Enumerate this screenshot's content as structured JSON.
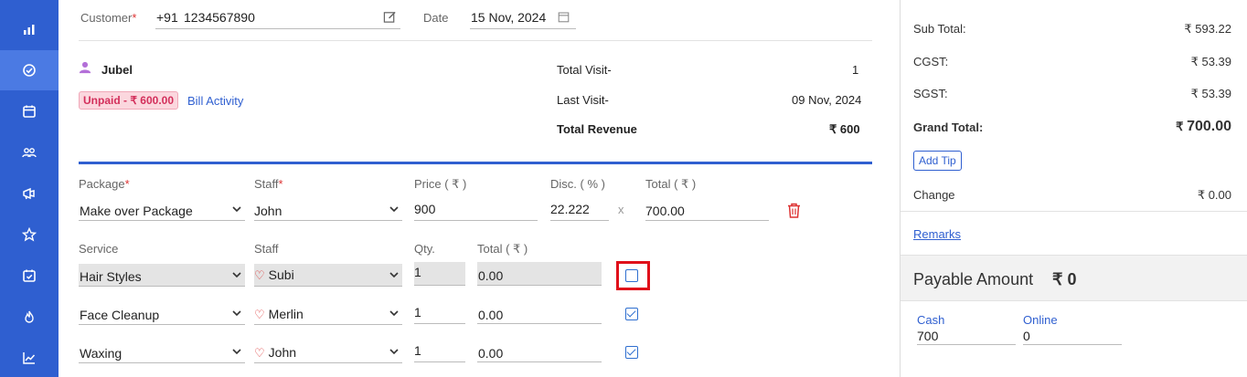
{
  "sidebar": {
    "items": [
      {
        "icon": "bar-chart-icon",
        "active": false
      },
      {
        "icon": "check-circle-icon",
        "active": true
      },
      {
        "icon": "calendar-icon",
        "active": false
      },
      {
        "icon": "group-icon",
        "active": false
      },
      {
        "icon": "megaphone-icon",
        "active": false
      },
      {
        "icon": "star-icon",
        "active": false
      },
      {
        "icon": "calendar-check-icon",
        "active": false
      },
      {
        "icon": "fire-icon",
        "active": false
      },
      {
        "icon": "trend-chart-icon",
        "active": false
      }
    ]
  },
  "customer": {
    "label": "Customer",
    "required_mark": "*",
    "country_code": "+91",
    "phone": "1234567890",
    "date_label": "Date",
    "date_value": "15 Nov, 2024"
  },
  "client": {
    "name": "Jubel",
    "unpaid_badge": "Unpaid - ₹ 600.00",
    "bill_activity": "Bill Activity",
    "total_visit_label": "Total Visit-",
    "total_visit_value": "1",
    "last_visit_label": "Last Visit-",
    "last_visit_value": "09 Nov, 2024",
    "total_revenue_label": "Total Revenue",
    "total_revenue_value": "₹ 600"
  },
  "package": {
    "headers": {
      "package": "Package",
      "staff": "Staff",
      "price": "Price ( ₹ )",
      "disc": "Disc. ( % )",
      "total": "Total ( ₹ )"
    },
    "required_mark": "*",
    "package_value": "Make over Package",
    "staff_value": "John",
    "price_value": "900",
    "disc_value": "22.222",
    "x_label": "x",
    "total_value": "700.00"
  },
  "services": {
    "headers": {
      "service": "Service",
      "staff": "Staff",
      "qty": "Qty.",
      "total": "Total ( ₹ )"
    },
    "rows": [
      {
        "service": "Hair Styles",
        "staff": "Subi",
        "qty": "1",
        "total": "0.00",
        "checked": false,
        "disabled": true
      },
      {
        "service": "Face Cleanup",
        "staff": "Merlin",
        "qty": "1",
        "total": "0.00",
        "checked": true,
        "disabled": false
      },
      {
        "service": "Waxing",
        "staff": "John",
        "qty": "1",
        "total": "0.00",
        "checked": true,
        "disabled": false
      }
    ]
  },
  "summary": {
    "sub_total_label": "Sub Total:",
    "sub_total_value": "₹ 593.22",
    "cgst_label": "CGST:",
    "cgst_value": "₹ 53.39",
    "sgst_label": "SGST:",
    "sgst_value": "₹ 53.39",
    "grand_total_label": "Grand Total:",
    "grand_total_currency": "₹",
    "grand_total_value": "700.00",
    "add_tip": "Add Tip",
    "change_label": "Change",
    "change_value": "₹ 0.00",
    "remarks": "Remarks",
    "payable_label": "Payable Amount",
    "payable_value": "₹ 0",
    "cash_label": "Cash",
    "cash_value": "700",
    "online_label": "Online",
    "online_value": "0"
  },
  "colors": {
    "sidebar": "#2f5fd0",
    "accent": "#2f5fd0",
    "highlight": "#e0101a",
    "danger": "#d33"
  }
}
